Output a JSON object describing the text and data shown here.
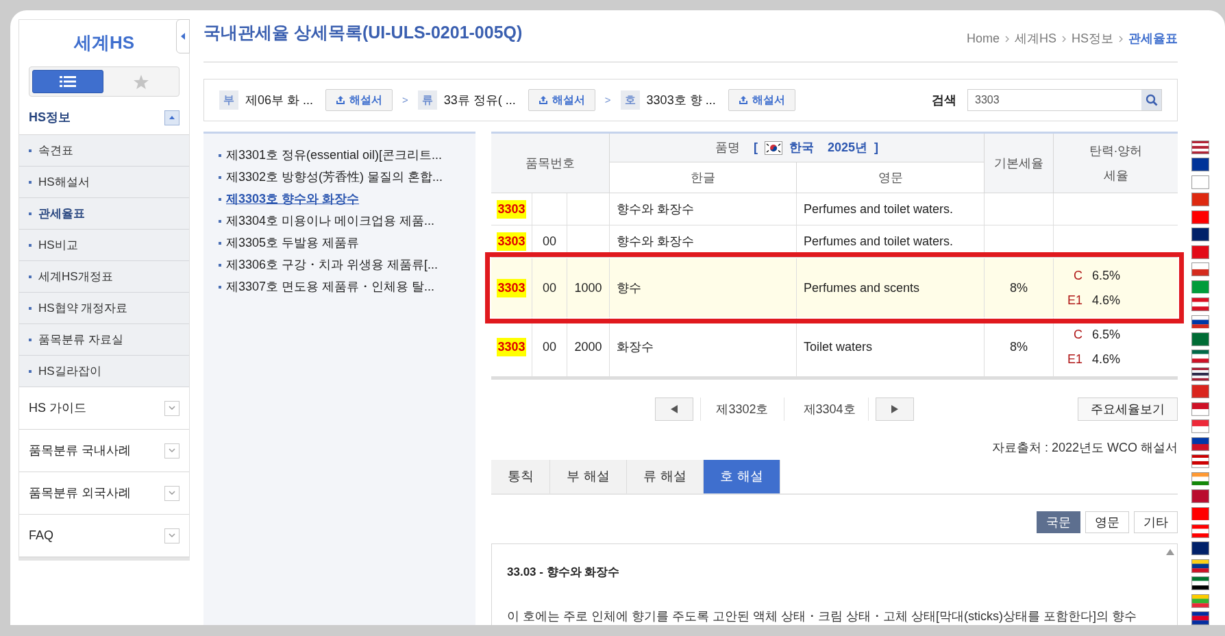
{
  "sidebar": {
    "title": "세계HS",
    "view_toggle": [
      {
        "kind": "list",
        "selected": true
      },
      {
        "kind": "star",
        "selected": false
      }
    ],
    "sections": [
      {
        "label": "HS정보",
        "expanded": true,
        "items": [
          {
            "label": "속견표",
            "selected": false
          },
          {
            "label": "HS해설서",
            "selected": false
          },
          {
            "label": "관세율표",
            "selected": true
          },
          {
            "label": "HS비교",
            "selected": false
          },
          {
            "label": "세계HS개정표",
            "selected": false
          },
          {
            "label": "HS협약 개정자료",
            "selected": false
          },
          {
            "label": "품목분류 자료실",
            "selected": false
          },
          {
            "label": "HS길라잡이",
            "selected": false
          }
        ]
      },
      {
        "label": "HS 가이드",
        "expanded": false
      },
      {
        "label": "품목분류 국내사례",
        "expanded": false
      },
      {
        "label": "품목분류 외국사례",
        "expanded": false
      },
      {
        "label": "FAQ",
        "expanded": false
      }
    ]
  },
  "page_title": "국내관세율 상세목록(UI-ULS-0201-005Q)",
  "breadcrumb": [
    {
      "label": "Home",
      "current": false
    },
    {
      "label": "세계HS",
      "current": false
    },
    {
      "label": "HS정보",
      "current": false
    },
    {
      "label": "관세율표",
      "current": true
    }
  ],
  "path": [
    {
      "badge": "부",
      "label": "제06부 화 ...",
      "button": "해설서"
    },
    {
      "badge": "류",
      "label": "33류 정유( ...",
      "button": "해설서"
    },
    {
      "badge": "호",
      "label": "3303호 향 ...",
      "button": "해설서"
    }
  ],
  "path_separator": ">",
  "search": {
    "label": "검색",
    "value": "3303"
  },
  "heading_list": [
    {
      "label": "제3301호 정유(essential oil)[콘크리트...",
      "selected": false
    },
    {
      "label": "제3302호 방향성(芳香性) 물질의 혼합...",
      "selected": false
    },
    {
      "label": "제3303호 향수와 화장수",
      "selected": true
    },
    {
      "label": "제3304호 미용이나 메이크업용 제품...",
      "selected": false
    },
    {
      "label": "제3305호 두발용 제품류",
      "selected": false
    },
    {
      "label": "제3306호 구강・치과 위생용 제품류[...",
      "selected": false
    },
    {
      "label": "제3307호 면도용 제품류・인체용 탈...",
      "selected": false
    }
  ],
  "table": {
    "col_code": "품목번호",
    "col_name": "품명",
    "name_open": "[",
    "country": "한국",
    "year": "2025년",
    "name_close": "]",
    "col_korean": "한글",
    "col_english": "영문",
    "col_base": "기본세율",
    "col_flex": "탄력·양허\n세율",
    "rows": [
      {
        "code": "3303",
        "sub": "",
        "sub2": "",
        "korean": "향수와 화장수",
        "english": "Perfumes and toilet waters.",
        "base": "",
        "rates": [],
        "highlighted": false
      },
      {
        "code": "3303",
        "sub": "00",
        "sub2": "",
        "korean": "향수와 화장수",
        "english": "Perfumes and toilet waters.",
        "base": "",
        "rates": [],
        "highlighted": false
      },
      {
        "code": "3303",
        "sub": "00",
        "sub2": "1000",
        "korean": "향수",
        "english": "Perfumes and scents",
        "base": "8%",
        "rates": [
          {
            "type": "C",
            "rate": "6.5%"
          },
          {
            "type": "E1",
            "rate": "4.6%"
          }
        ],
        "highlighted": true
      },
      {
        "code": "3303",
        "sub": "00",
        "sub2": "2000",
        "korean": "화장수",
        "english": "Toilet waters",
        "base": "8%",
        "rates": [
          {
            "type": "C",
            "rate": "6.5%"
          },
          {
            "type": "E1",
            "rate": "4.6%"
          }
        ],
        "highlighted": false
      }
    ]
  },
  "pager": {
    "prev": "제3302호",
    "next": "제3304호",
    "rates_button": "주요세율보기"
  },
  "source": "자료출처 : 2022년도 WCO 해설서",
  "tabs": [
    {
      "label": "통칙",
      "selected": false
    },
    {
      "label": "부 해설",
      "selected": false
    },
    {
      "label": "류 해설",
      "selected": false
    },
    {
      "label": "호 해설",
      "selected": true
    }
  ],
  "languages": [
    {
      "label": "국문",
      "selected": true
    },
    {
      "label": "영문",
      "selected": false
    },
    {
      "label": "기타",
      "selected": false
    }
  ],
  "commentary": {
    "heading": "33.03 - 향수와 화장수",
    "paragraph": "이 호에는 주로 인체에 향기를 주도록 고안된 액체 상태・크림 상태・고체 상태[막대(sticks)상태를 포함한다]의 향수"
  }
}
